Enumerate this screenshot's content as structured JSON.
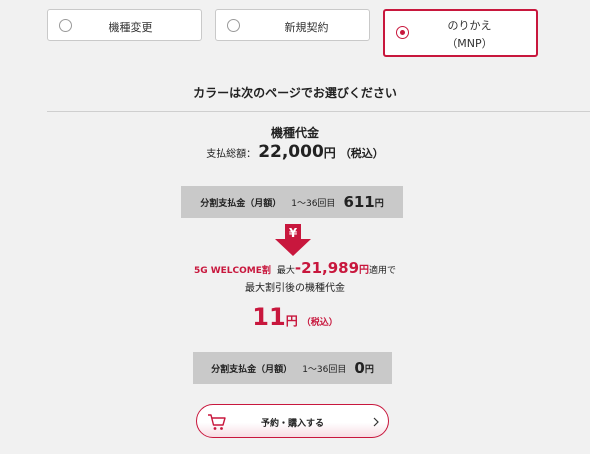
{
  "plan_options": [
    {
      "label": "機種変更",
      "selected": false
    },
    {
      "label": "新規契約",
      "selected": false
    },
    {
      "label_line1": "のりかえ",
      "label_line2": "（MNP）",
      "selected": true
    }
  ],
  "color_notice": "カラーは次のページでお選びください",
  "price": {
    "title": "機種代金",
    "total_label": "支払総額：",
    "total_amount": "22,000",
    "total_yen": "円",
    "total_tax": "（税込）"
  },
  "installment_1": {
    "label": "分割支払金（月額）",
    "range": "1～36回目",
    "amount": "611",
    "yen": "円"
  },
  "yen_symbol": "¥",
  "welcome": {
    "name": "5G WELCOME割",
    "max_prefix": "最大",
    "amount": "-21,989",
    "yen": "円",
    "applied": "適用で"
  },
  "after_discount_label": "最大割引後の機種代金",
  "final": {
    "amount": "11",
    "yen": "円",
    "tax": "（税込）"
  },
  "installment_2": {
    "label": "分割支払金（月額）",
    "range": "1～36回目",
    "amount": "0",
    "yen": "円"
  },
  "reserve_button": {
    "label": "予約・購入する"
  },
  "colors": {
    "accent": "#c8173d",
    "background": "#f1f1f1",
    "gray_box": "#c9c9c9"
  },
  "icons": [
    "radio-icon",
    "arrow-down-icon",
    "cart-icon",
    "chevron-right-icon"
  ]
}
